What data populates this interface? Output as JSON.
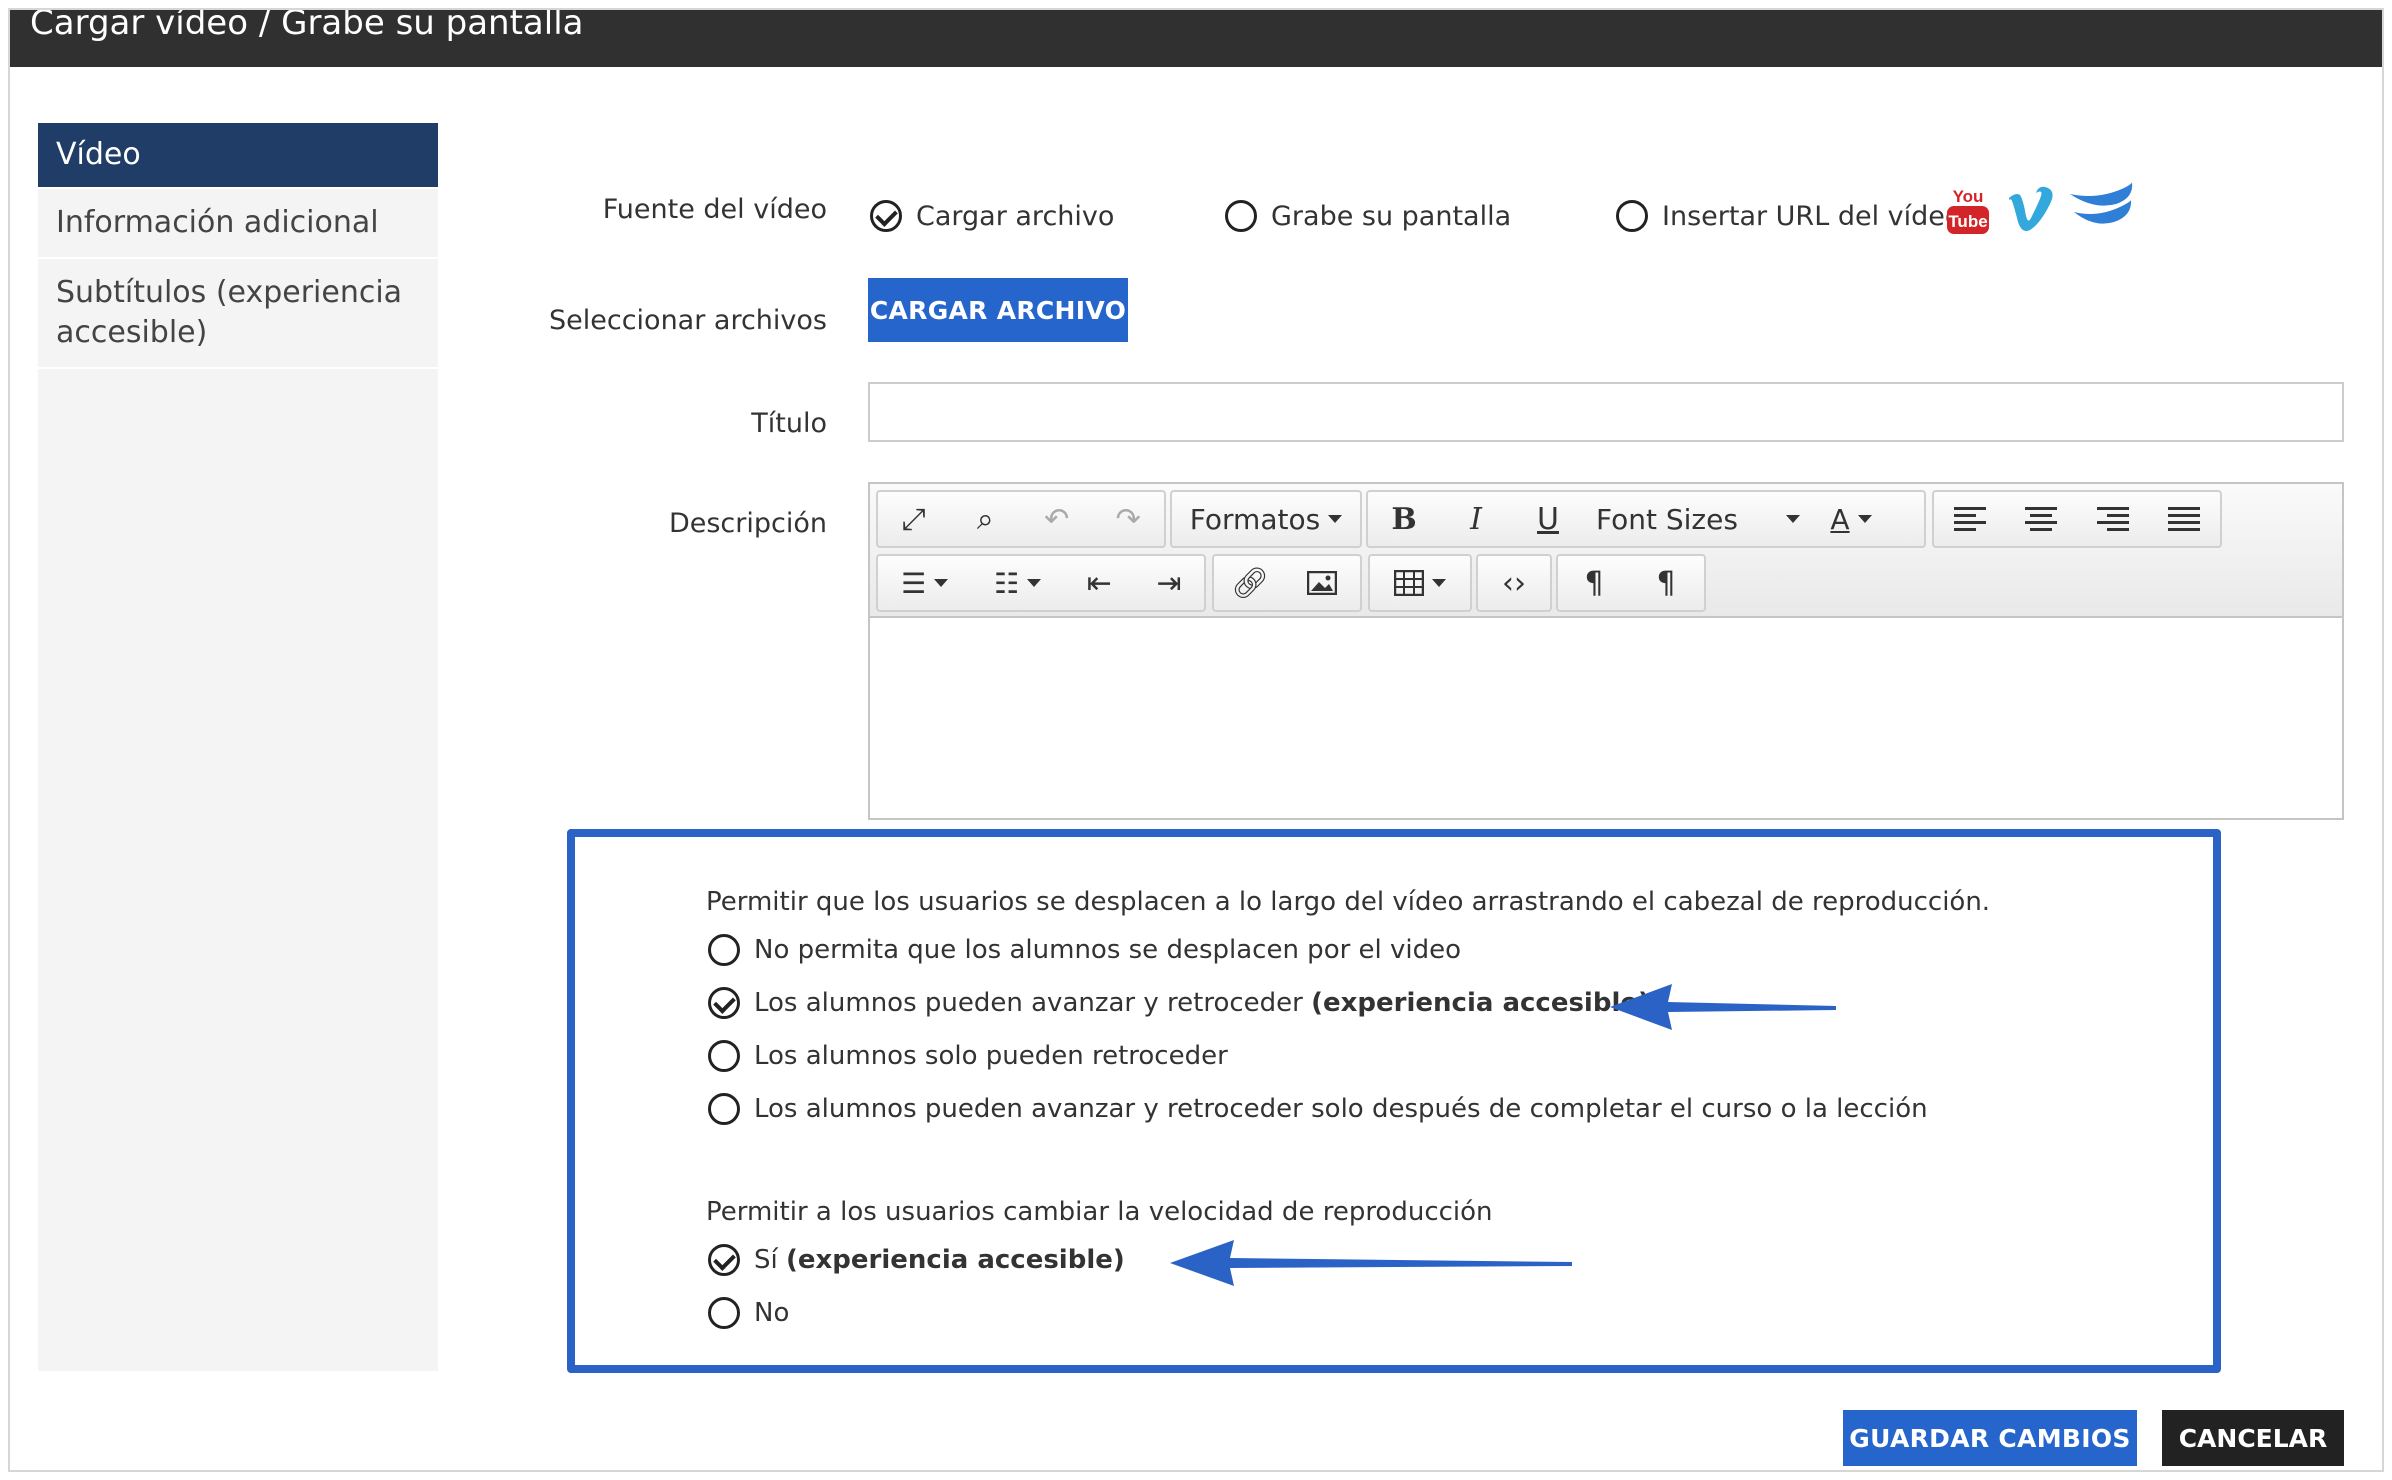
{
  "window": {
    "title": "Cargar vídeo / Grabe su pantalla"
  },
  "sidebar": {
    "items": [
      {
        "label": "Vídeo",
        "active": true
      },
      {
        "label": "Información adicional",
        "active": false
      },
      {
        "label": "Subtítulos (experiencia accesible)",
        "active": false
      }
    ]
  },
  "form": {
    "source_label": "Fuente del vídeo",
    "source_options": [
      "Cargar archivo",
      "Grabe su pantalla",
      "Insertar URL del vídeo"
    ],
    "source_selected": "Cargar archivo",
    "files_label": "Seleccionar archivos",
    "upload_button": "CARGAR ARCHIVO",
    "title_label": "Título",
    "title_value": "",
    "description_label": "Descripción"
  },
  "editor": {
    "formats_label": "Formatos",
    "font_sizes_label": "Font Sizes"
  },
  "icons": {
    "youtube": "youtube-icon",
    "vimeo": "vimeo-icon",
    "wistia": "wistia-icon",
    "youtube_text_top": "You",
    "youtube_text_bottom": "Tube"
  },
  "settings": {
    "seek_question": "Permitir que los usuarios se desplacen a lo largo del vídeo arrastrando el cabezal de reproducción.",
    "seek_options": [
      {
        "text": "No permita que los alumnos se desplacen por el video",
        "bold": "",
        "checked": false
      },
      {
        "text": "Los alumnos pueden avanzar y retroceder ",
        "bold": "(experiencia accesible)",
        "checked": true
      },
      {
        "text": "Los alumnos solo pueden retroceder",
        "bold": "",
        "checked": false
      },
      {
        "text": "Los alumnos pueden avanzar y retroceder solo después de completar el curso o la lección",
        "bold": "",
        "checked": false
      }
    ],
    "speed_question": "Permitir a los usuarios cambiar la velocidad de reproducción",
    "speed_options": [
      {
        "text": "Sí ",
        "bold": "(experiencia accesible)",
        "checked": true
      },
      {
        "text": "No",
        "bold": "",
        "checked": false
      }
    ]
  },
  "actions": {
    "save": "GUARDAR CAMBIOS",
    "cancel": "CANCELAR"
  },
  "colors": {
    "accent": "#2565cc",
    "sidebar_active": "#1f3d66",
    "panel_border": "#2a63c5",
    "titlebar": "#303030"
  }
}
